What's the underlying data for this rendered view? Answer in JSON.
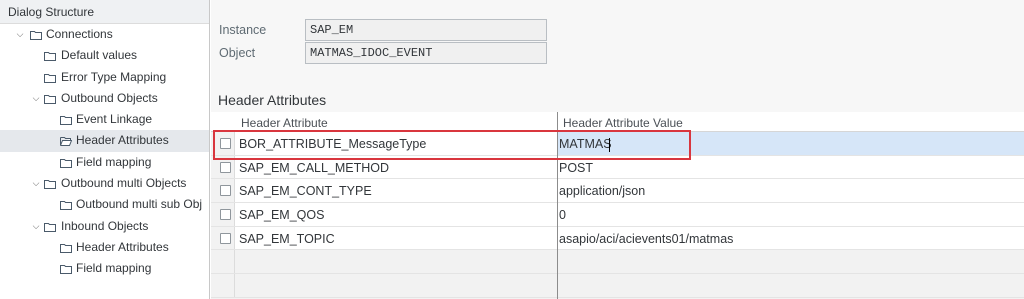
{
  "tree": {
    "header": "Dialog Structure",
    "items": [
      {
        "label": "Connections"
      },
      {
        "label": "Default values"
      },
      {
        "label": "Error Type Mapping"
      },
      {
        "label": "Outbound  Objects"
      },
      {
        "label": "Event Linkage"
      },
      {
        "label": "Header Attributes"
      },
      {
        "label": "Field mapping"
      },
      {
        "label": "Outbound multi Objects"
      },
      {
        "label": "Outbound multi sub Obj"
      },
      {
        "label": "Inbound Objects"
      },
      {
        "label": "Header Attributes"
      },
      {
        "label": "Field mapping"
      }
    ]
  },
  "form": {
    "instance_label": "Instance",
    "instance_value": "SAP_EM",
    "object_label": "Object",
    "object_value": "MATMAS_IDOC_EVENT"
  },
  "section_title": "Header Attributes",
  "table": {
    "col1": "Header Attribute",
    "col2": "Header Attribute Value",
    "rows": [
      {
        "attr": "BOR_ATTRIBUTE_MessageType",
        "value": "MATMAS"
      },
      {
        "attr": "SAP_EM_CALL_METHOD",
        "value": "POST"
      },
      {
        "attr": "SAP_EM_CONT_TYPE",
        "value": "application/json"
      },
      {
        "attr": "SAP_EM_QOS",
        "value": "0"
      },
      {
        "attr": "SAP_EM_TOPIC",
        "value": "asapio/aci/acievents01/matmas"
      }
    ]
  },
  "colors": {
    "highlight_border": "#d9363e",
    "selected_cell": "#d6e6f8",
    "selected_tree_item": "#e5e8ec"
  }
}
